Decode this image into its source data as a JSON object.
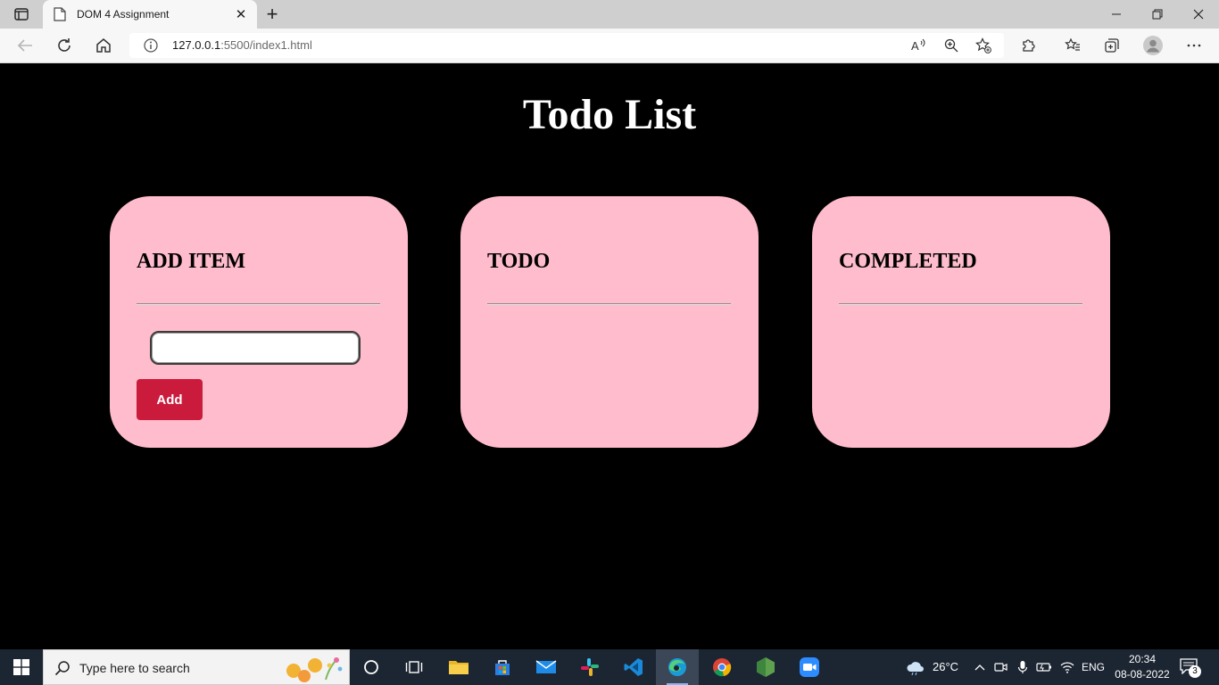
{
  "browser": {
    "tab_title": "DOM 4 Assignment",
    "tab_close": "✕",
    "new_tab": "+",
    "url_host": "127.0.0.1",
    "url_rest": ":5500/index1.html"
  },
  "page": {
    "title": "Todo List",
    "cards": {
      "add": {
        "heading": "ADD ITEM",
        "input_value": "",
        "button_label": "Add"
      },
      "todo": {
        "heading": "TODO"
      },
      "completed": {
        "heading": "COMPLETED"
      }
    }
  },
  "taskbar": {
    "search_placeholder": "Type here to search",
    "weather": "26°C",
    "language": "ENG",
    "time": "20:34",
    "date": "08-08-2022",
    "notification_count": "3"
  },
  "colors": {
    "card_bg": "#ffbccc",
    "add_button": "#cb1b3c",
    "page_bg": "#000000",
    "taskbar_bg": "#1c2532"
  }
}
